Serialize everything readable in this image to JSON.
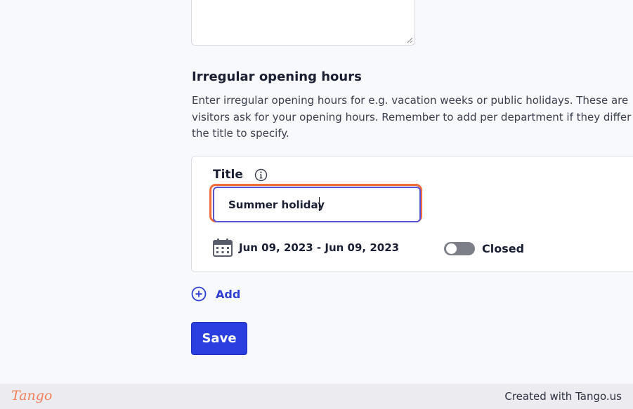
{
  "irregular_hours": {
    "heading": "Irregular opening hours",
    "description": "Enter irregular opening hours for e.g. vacation weeks or public holidays. These are visitors ask for your opening hours. Remember to add per department if they differ use the title to specify."
  },
  "entry": {
    "title_label": "Title",
    "title_value": "Summer holiday",
    "date_range": "Jun 09, 2023 - Jun 09, 2023",
    "closed_label": "Closed",
    "closed_enabled": false
  },
  "actions": {
    "add_label": "Add",
    "save_label": "Save"
  },
  "footer": {
    "logo": "Tango",
    "credit": "Created with Tango.us"
  },
  "colors": {
    "accent": "#2b3ee0",
    "highlight": "#f26b3a",
    "focus_border": "#5a52d5"
  },
  "icons": [
    "resize-grip-icon",
    "info-icon",
    "calendar-icon",
    "plus-circle-icon"
  ]
}
